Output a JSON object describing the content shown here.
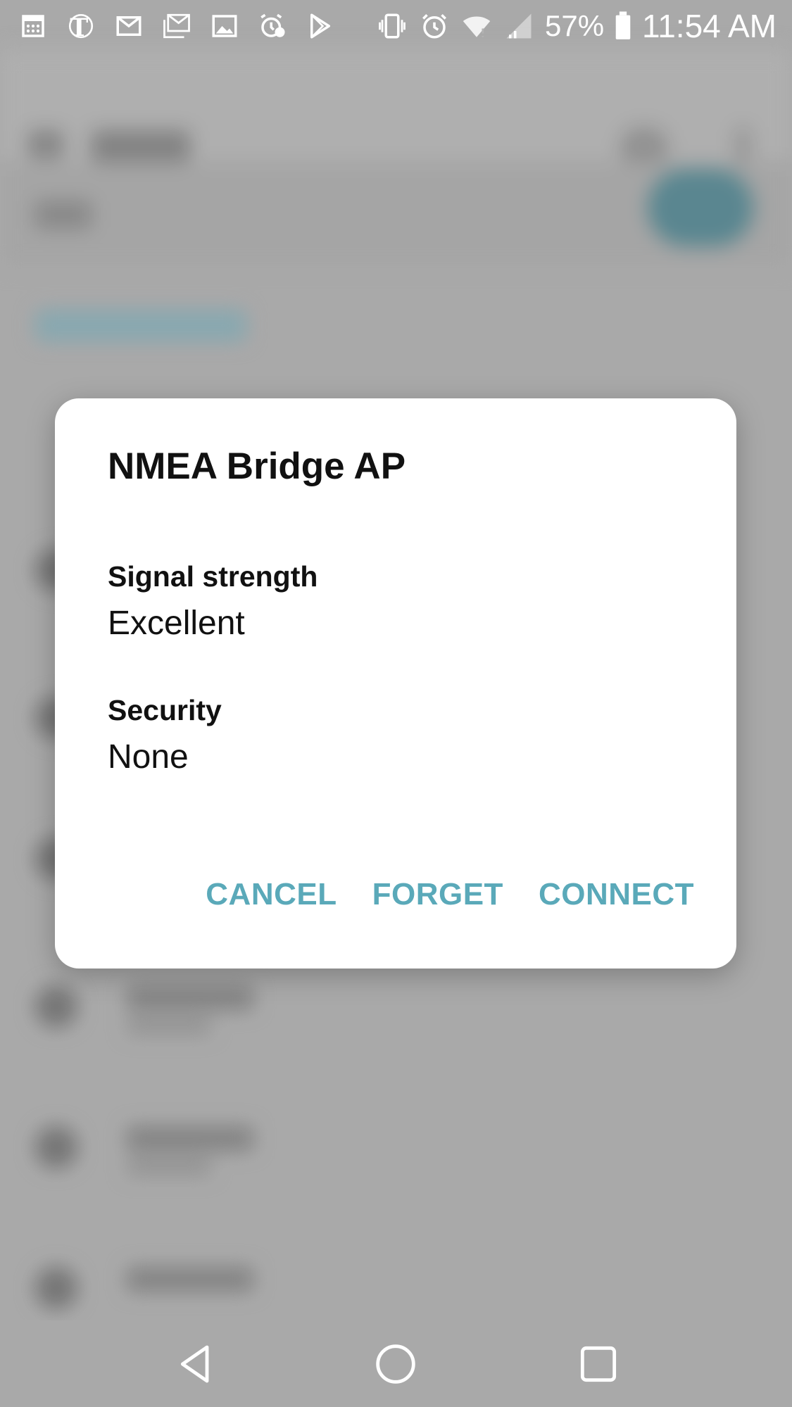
{
  "status_bar": {
    "left_icons": [
      "calendar-icon",
      "nytimes-icon",
      "gmail-icon",
      "gmail-stack-icon",
      "gallery-icon",
      "alarm-alert-icon",
      "play-store-icon"
    ],
    "right_icons": [
      "vibrate-icon",
      "alarm-icon",
      "wifi-icon",
      "cell-signal-icon"
    ],
    "battery_percent": "57%",
    "battery_level": 0.57,
    "time": "11:54 AM"
  },
  "dialog": {
    "title": "NMEA Bridge AP",
    "fields": [
      {
        "label": "Signal strength",
        "value": "Excellent"
      },
      {
        "label": "Security",
        "value": "None"
      }
    ],
    "buttons": {
      "cancel": "CANCEL",
      "forget": "FORGET",
      "connect": "CONNECT"
    }
  },
  "nav_bar": {
    "icons": [
      "back-icon",
      "home-icon",
      "recents-icon"
    ]
  },
  "colors": {
    "accent": "#5aa9b9",
    "background": "#b3b3b3",
    "dialog": "#ffffff"
  }
}
